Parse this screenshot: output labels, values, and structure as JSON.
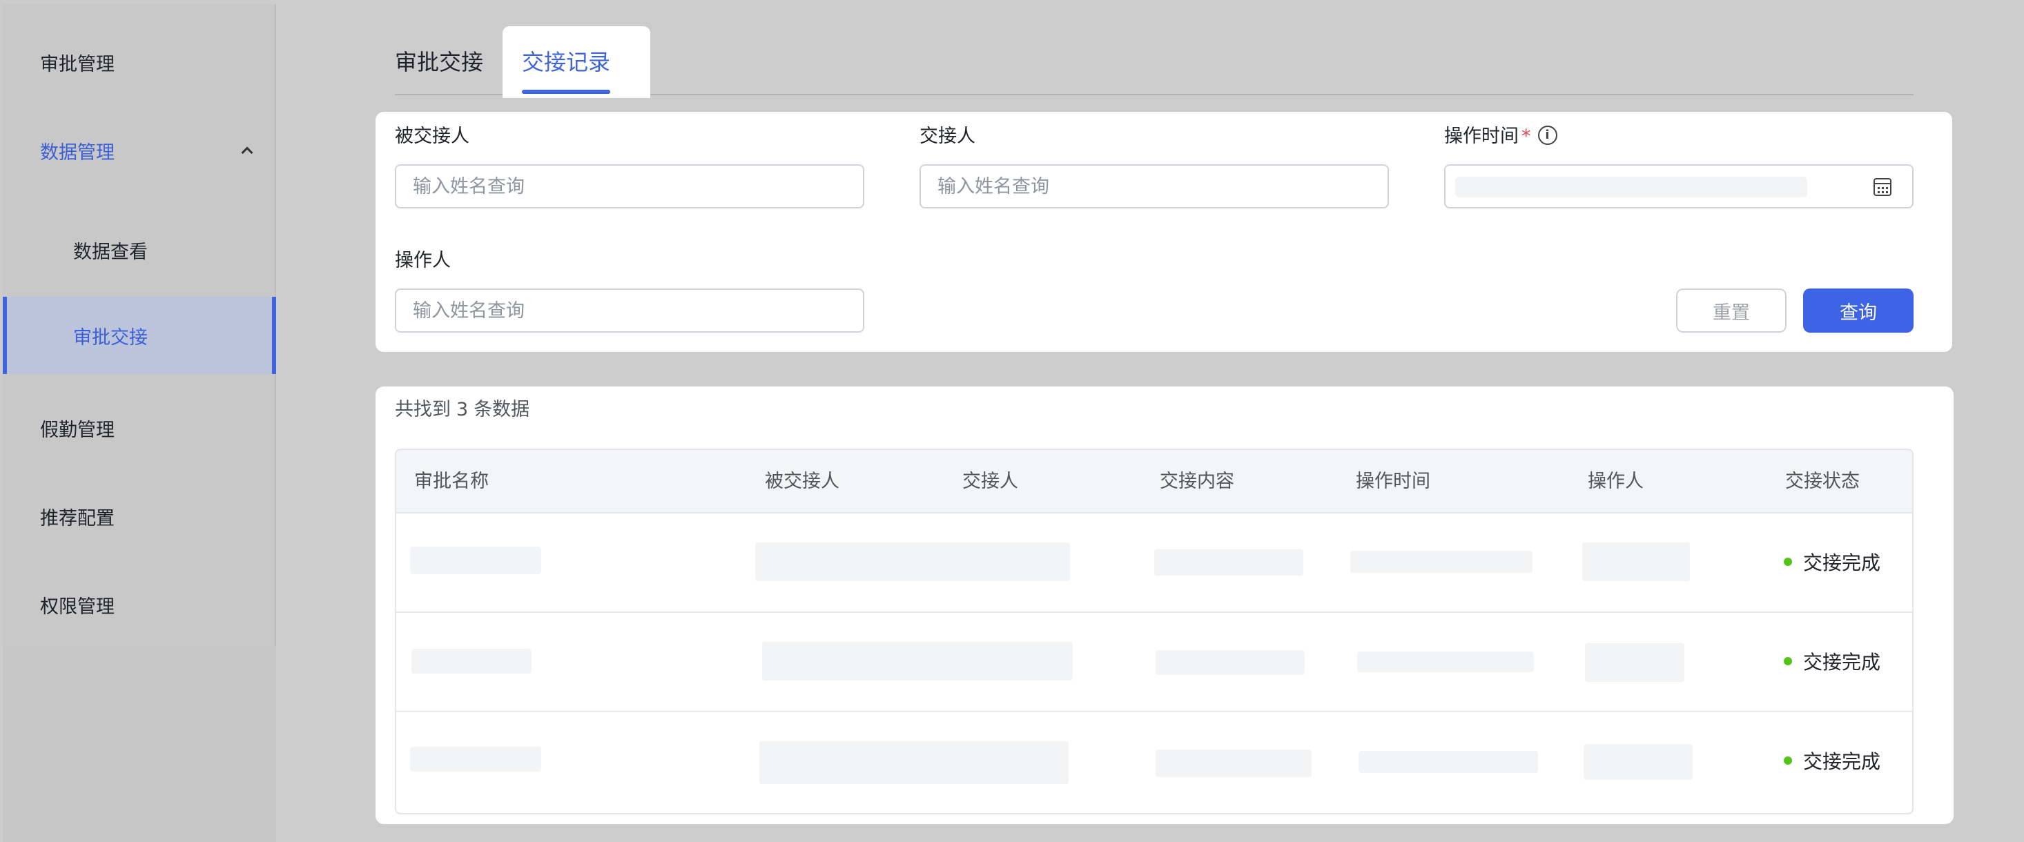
{
  "sidebar": {
    "items": [
      {
        "label": "审批管理"
      },
      {
        "label": "数据管理"
      },
      {
        "label": "数据查看"
      },
      {
        "label": "审批交接"
      },
      {
        "label": "假勤管理"
      },
      {
        "label": "推荐配置"
      },
      {
        "label": "权限管理"
      }
    ]
  },
  "tabs": [
    {
      "label": "审批交接",
      "active": false
    },
    {
      "label": "交接记录",
      "active": true
    }
  ],
  "filters": {
    "handover_from": {
      "label": "被交接人",
      "placeholder": "输入姓名查询",
      "value": ""
    },
    "handover_to": {
      "label": "交接人",
      "placeholder": "输入姓名查询",
      "value": ""
    },
    "operation_time": {
      "label": "操作时间",
      "required_mark": "*",
      "info_icon": "i",
      "icon": "calendar-icon"
    },
    "operator": {
      "label": "操作人",
      "placeholder": "输入姓名查询",
      "value": ""
    },
    "reset_label": "重置",
    "query_label": "查询"
  },
  "results": {
    "prefix": "共找到",
    "count": "3",
    "suffix": "条数据"
  },
  "table": {
    "columns": [
      "审批名称",
      "被交接人",
      "交接人",
      "交接内容",
      "操作时间",
      "操作人",
      "交接状态"
    ],
    "rows": [
      {
        "status": "交接完成"
      },
      {
        "status": "交接完成"
      },
      {
        "status": "交接完成"
      }
    ]
  },
  "colors": {
    "accent": "#3e64e6",
    "status_done": "#52c41a",
    "required": "#e5484d"
  }
}
